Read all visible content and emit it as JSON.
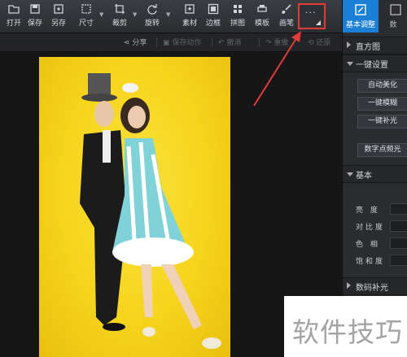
{
  "toolbar": {
    "open": "打开",
    "save": "保存",
    "save_as": "另存",
    "size": "尺寸",
    "crop": "裁剪",
    "rotate": "旋转",
    "material": "素材",
    "border": "边框",
    "collage": "拼图",
    "template": "模板",
    "brush": "画笔",
    "more_icon": "more-dots-icon"
  },
  "subbar": {
    "share": "分享",
    "save_action": "保存动作",
    "undo": "撤消",
    "redo": "重做",
    "restore": "还原"
  },
  "panel": {
    "tab_basic": "基本调整",
    "tab_second": "数",
    "histogram": "直方图",
    "one_click": "一键设置",
    "auto_beautify": "自动美化",
    "one_click_blur": "一键模糊",
    "one_click_fill": "一键补光",
    "digital_fill": "数字点频光",
    "basic": "基本",
    "brightness": "亮 度",
    "contrast": "对比度",
    "hue": "色 相",
    "saturation": "饱和度",
    "digital_compensate": "数码补光"
  },
  "watermark": {
    "text": "软件技巧"
  },
  "colors": {
    "accent": "#1c7fd6",
    "highlight": "#e23b3b",
    "photo_bg": "#f6d41a"
  }
}
